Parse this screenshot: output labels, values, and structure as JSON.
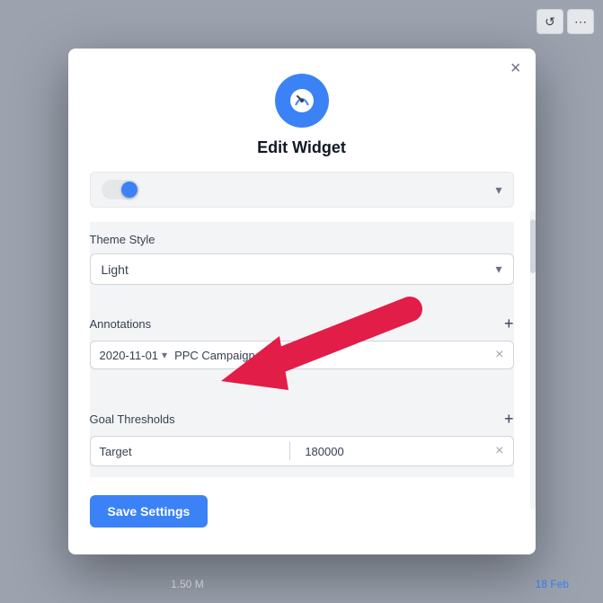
{
  "background": {
    "color": "#9ca3af"
  },
  "topBar": {
    "resetButton": "↺",
    "moreButton": "⋯"
  },
  "bottomLabels": {
    "value": "1.50 M",
    "date": "18 Feb"
  },
  "modal": {
    "closeLabel": "×",
    "iconAlt": "widget-gauge-icon",
    "title": "Edit Widget",
    "toggleRow": {
      "chevron": "▾"
    },
    "themeStyle": {
      "label": "Theme Style",
      "value": "Light",
      "chevron": "▾"
    },
    "annotations": {
      "label": "Annotations",
      "addIcon": "+",
      "rows": [
        {
          "date": "2020-11-01",
          "text": "PPC Campaign",
          "removeIcon": "×"
        }
      ]
    },
    "goalThresholds": {
      "label": "Goal Thresholds",
      "addIcon": "+",
      "rows": [
        {
          "label": "Target",
          "value": "180000",
          "removeIcon": "×"
        }
      ]
    },
    "saveButton": "Save Settings"
  }
}
